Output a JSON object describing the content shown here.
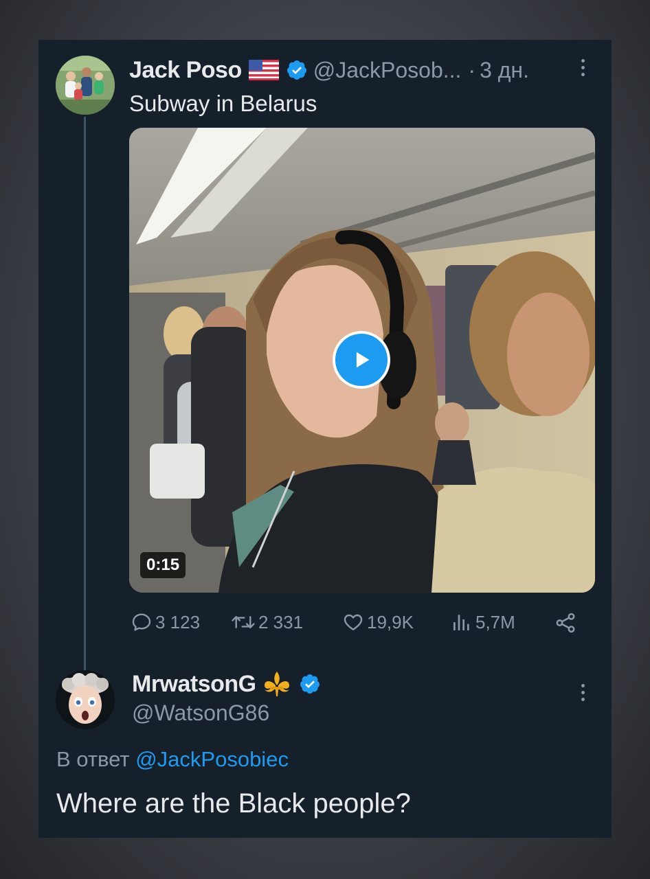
{
  "tweet": {
    "author_name": "Jack Poso",
    "flag_emoji": "🇺🇸",
    "handle": "@JackPosob...",
    "separator": "·",
    "time": "3 дн.",
    "text": "Subway in Belarus",
    "video_duration": "0:15",
    "stats": {
      "replies": "3 123",
      "retweets": "2 331",
      "likes": "19,9K",
      "views": "5,7M"
    }
  },
  "reply": {
    "author_name": "MrwatsonG",
    "fleur_emoji": "⚜️",
    "handle": "@WatsonG86",
    "reply_prefix": "В ответ",
    "reply_mention": "@JackPosobiec",
    "text": "Where are the Black people?"
  },
  "colors": {
    "background": "#15202b",
    "primary_text": "#e7e9ea",
    "secondary_text": "#8b98a5",
    "accent": "#1d9bf0"
  },
  "icons": [
    "flag-us-icon",
    "verified-badge-icon",
    "more-options-icon",
    "play-icon",
    "reply-icon",
    "retweet-icon",
    "like-icon",
    "views-icon",
    "share-icon",
    "fleur-de-lis-icon"
  ]
}
